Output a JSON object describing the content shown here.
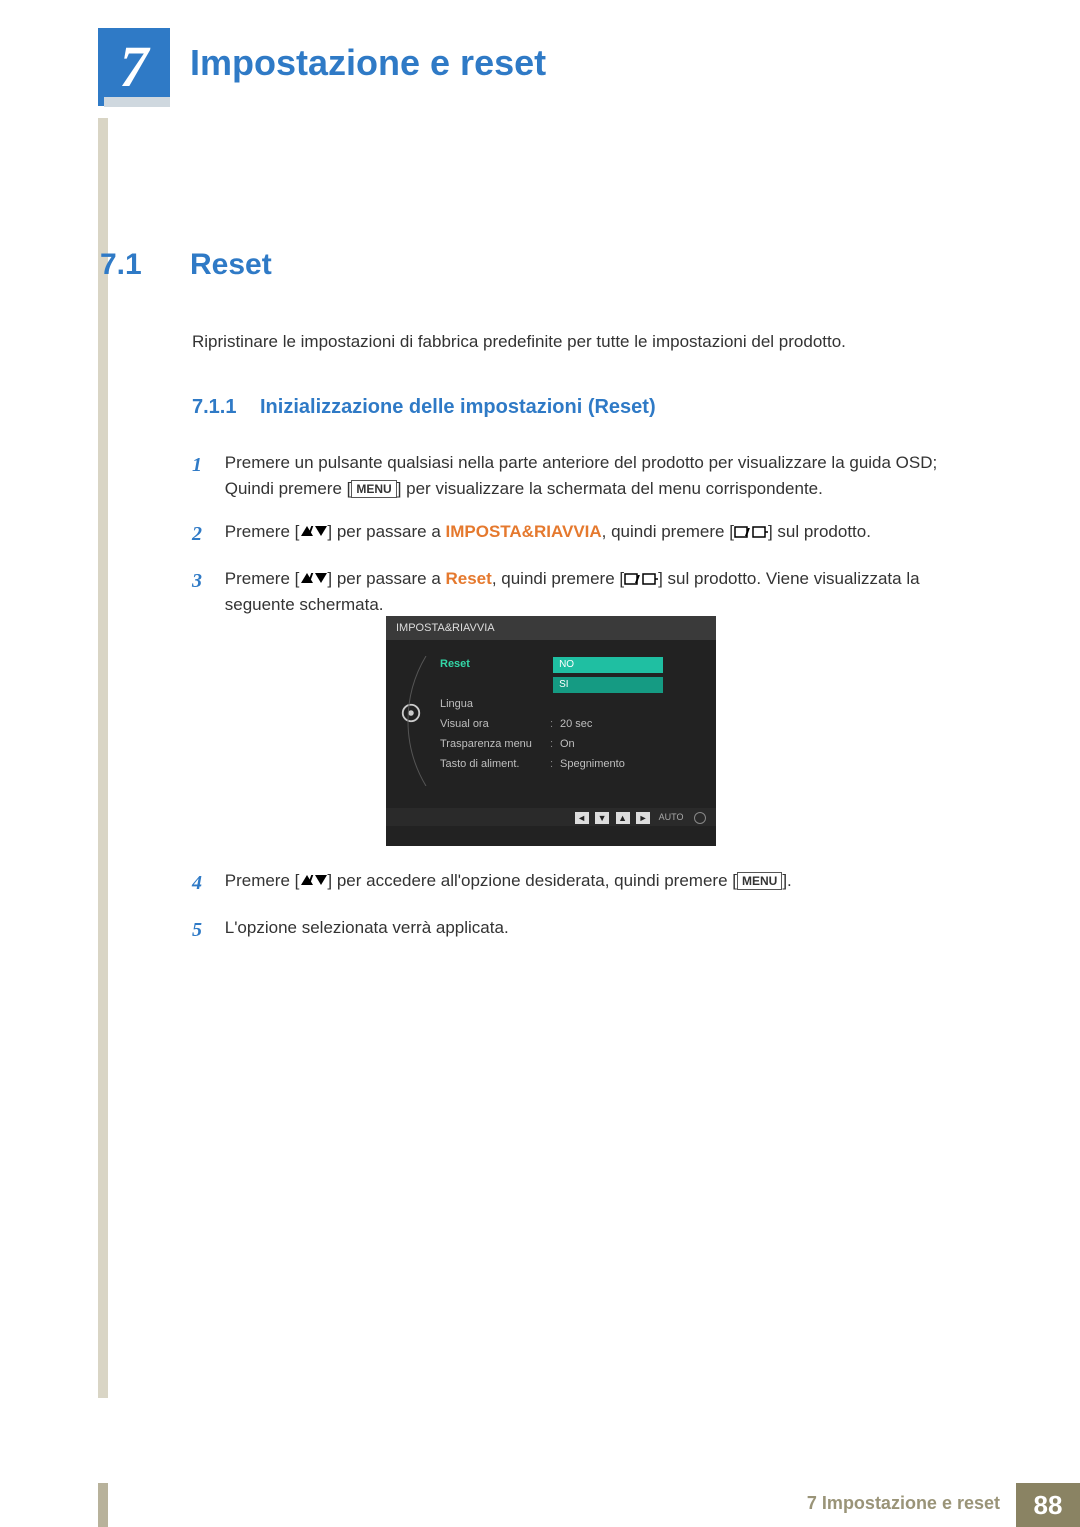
{
  "chapter": {
    "number": "7",
    "title": "Impostazione e reset"
  },
  "section": {
    "number": "7.1",
    "title": "Reset"
  },
  "intro": "Ripristinare le impostazioni di fabbrica predefinite per tutte le impostazioni del prodotto.",
  "subsection": {
    "number": "7.1.1",
    "title": "Inizializzazione delle impostazioni (Reset)"
  },
  "steps": {
    "s1n": "1",
    "s1a": "Premere un pulsante qualsiasi nella parte anteriore del prodotto per visualizzare la guida OSD; Quindi premere [",
    "s1b": "] per visualizzare la schermata del menu corrispondente.",
    "menu_label": "MENU",
    "s2n": "2",
    "s2a": "Premere [",
    "s2b": "] per passare a ",
    "s2c": "IMPOSTA&RIAVVIA",
    "s2d": ", quindi premere [",
    "s2e": "] sul prodotto.",
    "s3n": "3",
    "s3a": "Premere [",
    "s3b": "] per passare a ",
    "s3c": "Reset",
    "s3d": ", quindi premere [",
    "s3e": "] sul prodotto. Viene visualizzata la seguente schermata.",
    "s4n": "4",
    "s4a": "Premere [",
    "s4b": "] per accedere all'opzione desiderata, quindi premere [",
    "s4c": "].",
    "s5n": "5",
    "s5": "L'opzione selezionata verrà applicata."
  },
  "osd": {
    "title": "IMPOSTA&RIAVVIA",
    "rows": {
      "reset": "Reset",
      "reset_no": "NO",
      "reset_si": "SI",
      "lingua": "Lingua",
      "visual_ora": "Visual ora",
      "visual_ora_val": "20 sec",
      "trasp": "Trasparenza menu",
      "trasp_val": "On",
      "tasto": "Tasto di aliment.",
      "tasto_val": "Spegnimento"
    },
    "footer_auto": "AUTO",
    "footer_keys": {
      "left": "◄",
      "down": "▼",
      "up": "▲",
      "right": "►"
    }
  },
  "footer": {
    "text": "7 Impostazione e reset",
    "page": "88"
  }
}
